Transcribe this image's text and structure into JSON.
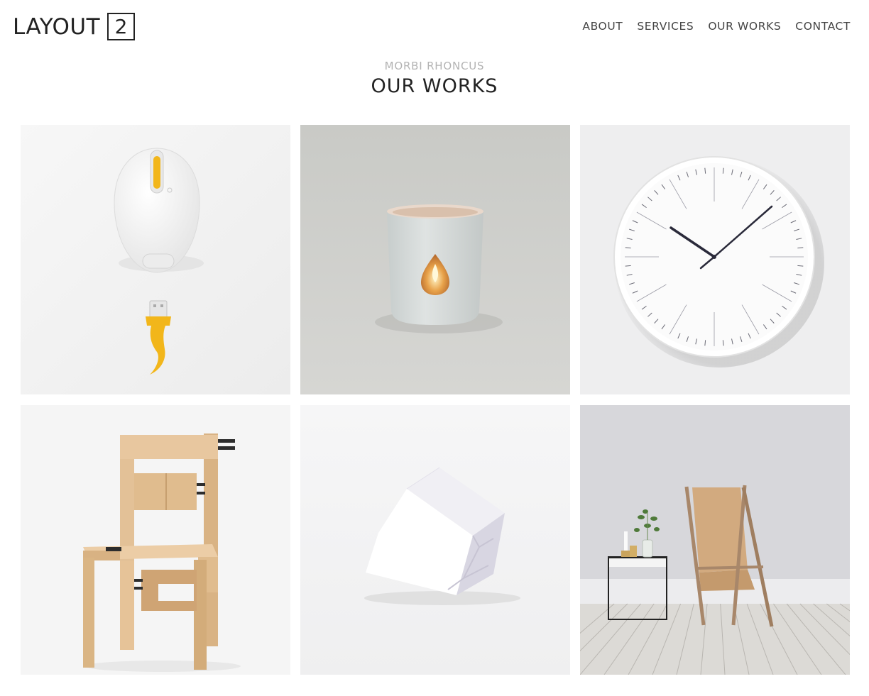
{
  "header": {
    "logo_text": "LAYOUT",
    "logo_number": "2",
    "nav": [
      "ABOUT",
      "SERVICES",
      "OUR WORKS",
      "CONTACT"
    ]
  },
  "section": {
    "subtitle": "MORBI RHONCUS",
    "title": "OUR WORKS"
  },
  "works": [
    {
      "name": "mouse-and-usb",
      "bg": "#f2f2f2"
    },
    {
      "name": "candle",
      "bg": "#cfcfcc"
    },
    {
      "name": "wall-clock",
      "bg": "#eeeeef"
    },
    {
      "name": "wooden-chair",
      "bg": "#f4f4f4"
    },
    {
      "name": "white-cube",
      "bg": "#f3f3f4"
    },
    {
      "name": "leather-chair-room",
      "bg": "#d8d8dc"
    }
  ],
  "colors": {
    "accent_yellow": "#f2b61a",
    "text_dark": "#222222",
    "text_muted": "#b3b3b3"
  }
}
